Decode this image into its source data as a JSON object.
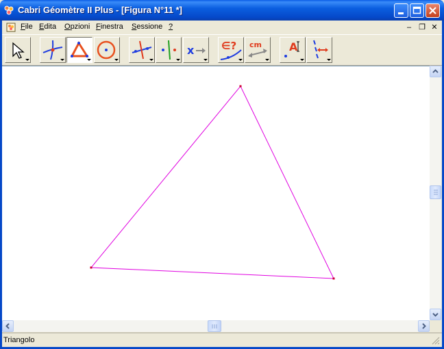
{
  "window": {
    "title": "Cabri Géomètre II Plus - [Figura N°11 *]"
  },
  "menu": {
    "items": [
      {
        "label": "File",
        "u": "F",
        "rest": "ile"
      },
      {
        "label": "Edita",
        "u": "E",
        "rest": "dita"
      },
      {
        "label": "Opzioni",
        "u": "O",
        "rest": "pzioni"
      },
      {
        "label": "Finestra",
        "u": "F",
        "rest": "inestra"
      },
      {
        "label": "Sessione",
        "u": "S",
        "rest": "essione"
      },
      {
        "label": "?",
        "u": "?",
        "rest": ""
      }
    ]
  },
  "toolbar": {
    "tools": [
      {
        "name": "pointer-tool",
        "icon": "arrow-pointer-icon"
      },
      {
        "name": "points-tool",
        "icon": "point-curves-icon"
      },
      {
        "name": "triangle-tool",
        "icon": "triangle-icon",
        "active": true
      },
      {
        "name": "circle-tool",
        "icon": "circle-icon"
      },
      {
        "name": "construct-tool",
        "icon": "perpendicular-icon"
      },
      {
        "name": "transform-tool",
        "icon": "symmetry-icon"
      },
      {
        "name": "macro-tool",
        "icon": "macro-x-icon"
      },
      {
        "name": "check-property-tool",
        "icon": "member-question-icon"
      },
      {
        "name": "measure-tool",
        "icon": "measure-cm-icon"
      },
      {
        "name": "display-tool",
        "icon": "label-a-icon"
      },
      {
        "name": "drawing-tool",
        "icon": "hide-show-icon"
      }
    ],
    "labels": {
      "measure": "cm",
      "display": "A",
      "check": "∈?"
    }
  },
  "colors": {
    "triangle": "#E000E0",
    "vertex": "#CC0033",
    "title_bar": "#0548C8"
  },
  "status": {
    "text": "Triangolo"
  }
}
